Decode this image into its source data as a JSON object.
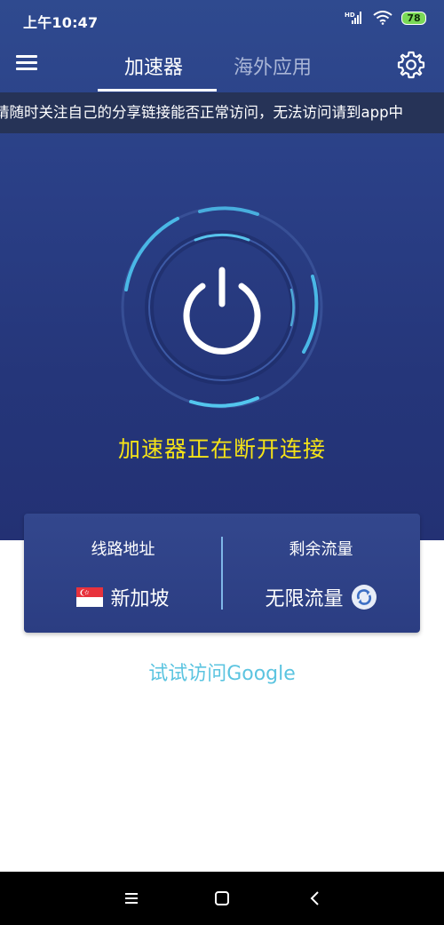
{
  "status_bar": {
    "time": "上午10:47",
    "signal_label": "HD",
    "battery": "78"
  },
  "header": {
    "tabs": [
      {
        "label": "加速器",
        "active": true
      },
      {
        "label": "海外应用",
        "active": false
      }
    ]
  },
  "ticker": {
    "text": "请随时关注自己的分享链接能否正常访问，无法访问请到app中"
  },
  "power": {
    "status_text": "加速器正在断开连接"
  },
  "info_card": {
    "route_label": "线路地址",
    "route_value": "新加坡",
    "traffic_label": "剩余流量",
    "traffic_value": "无限流量"
  },
  "google_link": "试试访问Google",
  "colors": {
    "accent_yellow": "#f5e317",
    "link_cyan": "#5bc4e0",
    "hero_blue": "#2a3f86"
  }
}
